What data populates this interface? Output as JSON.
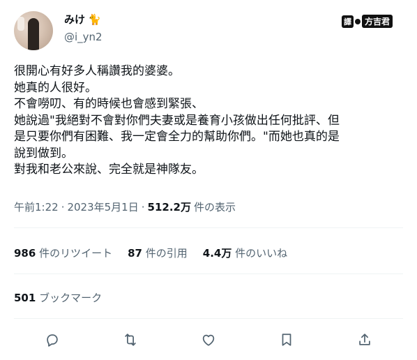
{
  "author": {
    "display_name": "みけ",
    "name_icon": "cat-emoji-icon",
    "handle": "@i_yn2"
  },
  "watermark": {
    "box": "譯",
    "text": "方吉君"
  },
  "tweet": {
    "lines": [
      "很開心有好多人稱讚我的婆婆。",
      "她真的人很好。",
      "不會嘮叨、有的時候也會感到緊張、",
      "她說過\"我絕對不會對你們夫妻或是養育小孩做出任何批評、但",
      "是只要你們有困難、我一定會全力的幫助你們。\"而她也真的是",
      "說到做到。",
      "對我和老公來說、完全就是神隊友。"
    ]
  },
  "meta": {
    "time": "午前1:22",
    "date": "2023年5月1日",
    "views_count": "512.2万",
    "views_label": "件の表示"
  },
  "stats": {
    "retweets_count": "986",
    "retweets_label": "件のリツイート",
    "quotes_count": "87",
    "quotes_label": "件の引用",
    "likes_count": "4.4万",
    "likes_label": "件のいいね"
  },
  "bookmarks": {
    "count": "501",
    "label": "ブックマーク"
  },
  "actions": [
    "reply-icon",
    "retweet-icon",
    "like-icon",
    "bookmark-icon",
    "share-icon"
  ]
}
